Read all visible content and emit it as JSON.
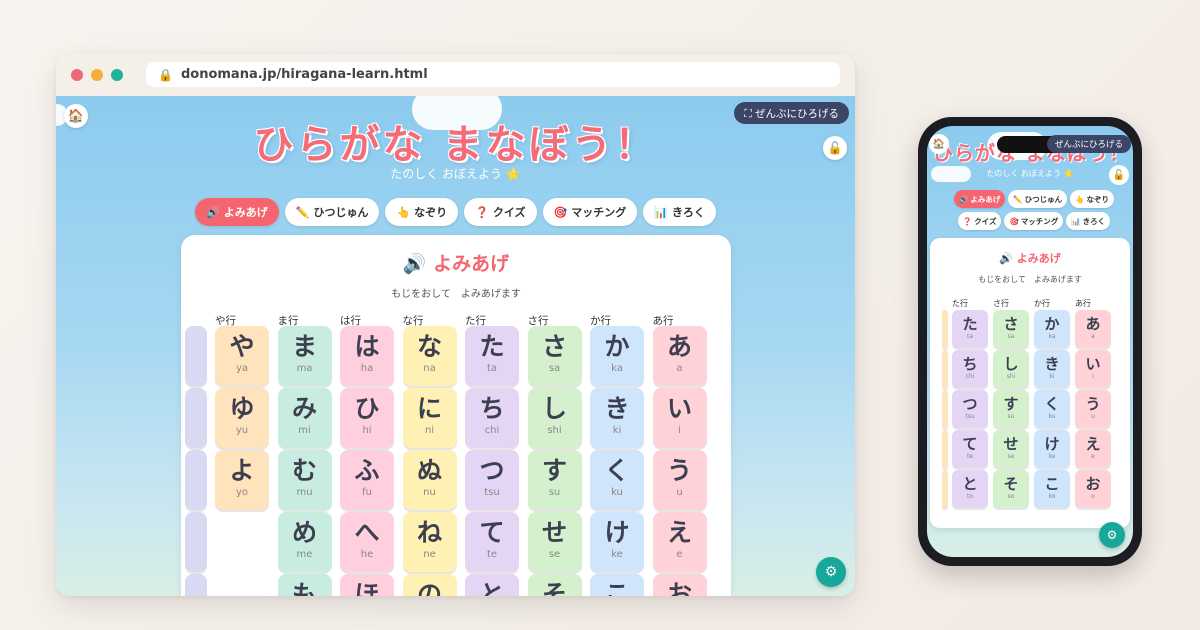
{
  "browser": {
    "url": "donomana.jp/hiragana-learn.html"
  },
  "app": {
    "title": "ひらがな まなぼう！",
    "subtitle": "たのしく おぼえよう ⭐",
    "fullscreen_label": "⛶ ぜんぶにひろげる",
    "home_icon": "🏠",
    "unlock_icon": "🔓",
    "settings_icon": "⚙"
  },
  "tabs": [
    {
      "icon": "🔊",
      "label": "よみあげ",
      "active": true
    },
    {
      "icon": "✏️",
      "label": "ひつじゅん",
      "active": false
    },
    {
      "icon": "👆",
      "label": "なぞり",
      "active": false
    },
    {
      "icon": "❓",
      "label": "クイズ",
      "active": false
    },
    {
      "icon": "🎯",
      "label": "マッチング",
      "active": false
    },
    {
      "icon": "📊",
      "label": "きろく",
      "active": false
    }
  ],
  "card": {
    "title": "🔊 よみあげ",
    "subtitle": "もじをおして　よみあげます"
  },
  "colors": {
    "ya": "#ffe3bd",
    "ma": "#c9ece0",
    "ha": "#ffcfde",
    "na": "#fff0b3",
    "ta": "#e3d5f3",
    "sa": "#d5f0cd",
    "ka": "#cfe5fb",
    "a": "#ffd2d8",
    "wa": "#d9d9f4"
  },
  "grid": [
    {
      "row": "や行",
      "key": "ya",
      "chars": [
        {
          "k": "や",
          "r": "ya"
        },
        {
          "k": "ゆ",
          "r": "yu"
        },
        {
          "k": "よ",
          "r": "yo"
        }
      ]
    },
    {
      "row": "ま行",
      "key": "ma",
      "chars": [
        {
          "k": "ま",
          "r": "ma"
        },
        {
          "k": "み",
          "r": "mi"
        },
        {
          "k": "む",
          "r": "mu"
        },
        {
          "k": "め",
          "r": "me"
        },
        {
          "k": "も",
          "r": ""
        }
      ]
    },
    {
      "row": "は行",
      "key": "ha",
      "chars": [
        {
          "k": "は",
          "r": "ha"
        },
        {
          "k": "ひ",
          "r": "hi"
        },
        {
          "k": "ふ",
          "r": "fu"
        },
        {
          "k": "へ",
          "r": "he"
        },
        {
          "k": "ほ",
          "r": ""
        }
      ]
    },
    {
      "row": "な行",
      "key": "na",
      "chars": [
        {
          "k": "な",
          "r": "na"
        },
        {
          "k": "に",
          "r": "ni"
        },
        {
          "k": "ぬ",
          "r": "nu"
        },
        {
          "k": "ね",
          "r": "ne"
        },
        {
          "k": "の",
          "r": ""
        }
      ]
    },
    {
      "row": "た行",
      "key": "ta",
      "chars": [
        {
          "k": "た",
          "r": "ta"
        },
        {
          "k": "ち",
          "r": "chi"
        },
        {
          "k": "つ",
          "r": "tsu"
        },
        {
          "k": "て",
          "r": "te"
        },
        {
          "k": "と",
          "r": ""
        }
      ]
    },
    {
      "row": "さ行",
      "key": "sa",
      "chars": [
        {
          "k": "さ",
          "r": "sa"
        },
        {
          "k": "し",
          "r": "shi"
        },
        {
          "k": "す",
          "r": "su"
        },
        {
          "k": "せ",
          "r": "se"
        },
        {
          "k": "そ",
          "r": ""
        }
      ]
    },
    {
      "row": "か行",
      "key": "ka",
      "chars": [
        {
          "k": "か",
          "r": "ka"
        },
        {
          "k": "き",
          "r": "ki"
        },
        {
          "k": "く",
          "r": "ku"
        },
        {
          "k": "け",
          "r": "ke"
        },
        {
          "k": "こ",
          "r": ""
        }
      ]
    },
    {
      "row": "あ行",
      "key": "a",
      "chars": [
        {
          "k": "あ",
          "r": "a"
        },
        {
          "k": "い",
          "r": "i"
        },
        {
          "k": "う",
          "r": "u"
        },
        {
          "k": "え",
          "r": "e"
        },
        {
          "k": "お",
          "r": ""
        }
      ]
    }
  ],
  "phone": {
    "title": "ひらがな まなぼう！",
    "fullscreen_label": "ぜんぶにひろげる",
    "subtitle": "たのしく おぼえよう ⭐",
    "card_title": "🔊 よみあげ",
    "card_subtitle": "もじをおして　よみあげます",
    "grid": [
      {
        "row": "た行",
        "key": "ta",
        "chars": [
          {
            "k": "た",
            "r": "ta"
          },
          {
            "k": "ち",
            "r": "chi"
          },
          {
            "k": "つ",
            "r": "tsu"
          },
          {
            "k": "て",
            "r": "te"
          },
          {
            "k": "と",
            "r": "to"
          }
        ]
      },
      {
        "row": "さ行",
        "key": "sa",
        "chars": [
          {
            "k": "さ",
            "r": "sa"
          },
          {
            "k": "し",
            "r": "shi"
          },
          {
            "k": "す",
            "r": "su"
          },
          {
            "k": "せ",
            "r": "se"
          },
          {
            "k": "そ",
            "r": "so"
          }
        ]
      },
      {
        "row": "か行",
        "key": "ka",
        "chars": [
          {
            "k": "か",
            "r": "ka"
          },
          {
            "k": "き",
            "r": "ki"
          },
          {
            "k": "く",
            "r": "ku"
          },
          {
            "k": "け",
            "r": "ke"
          },
          {
            "k": "こ",
            "r": "ko"
          }
        ]
      },
      {
        "row": "あ行",
        "key": "a",
        "chars": [
          {
            "k": "あ",
            "r": "a"
          },
          {
            "k": "い",
            "r": "i"
          },
          {
            "k": "う",
            "r": "u"
          },
          {
            "k": "え",
            "r": "e"
          },
          {
            "k": "お",
            "r": "o"
          }
        ]
      }
    ]
  }
}
